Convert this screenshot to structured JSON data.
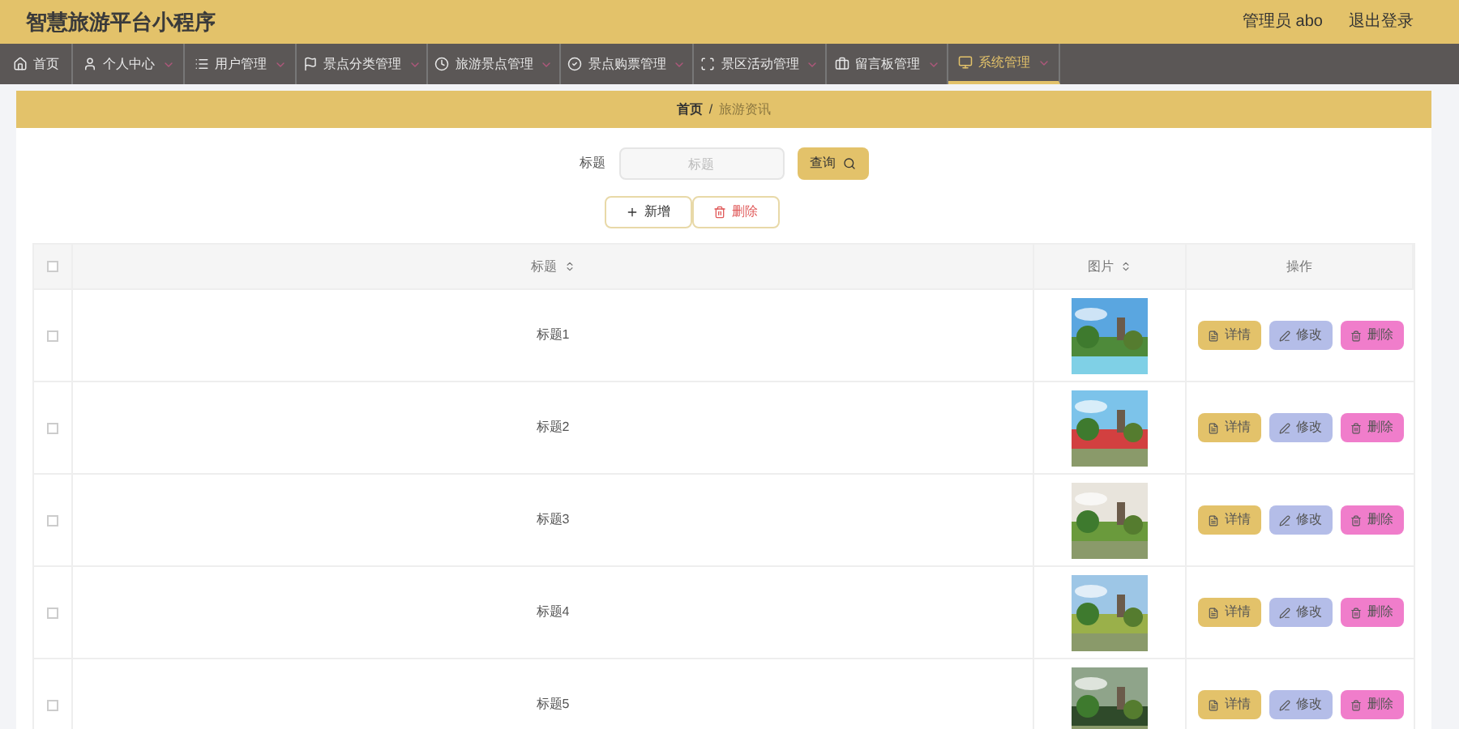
{
  "header": {
    "title": "智慧旅游平台小程序",
    "user": "管理员 abo",
    "logout": "退出登录"
  },
  "nav": [
    {
      "label": "首页",
      "dropdown": false,
      "selected": false
    },
    {
      "label": "个人中心",
      "dropdown": true,
      "selected": false
    },
    {
      "label": "用户管理",
      "dropdown": true,
      "selected": false
    },
    {
      "label": "景点分类管理",
      "dropdown": true,
      "selected": false
    },
    {
      "label": "旅游景点管理",
      "dropdown": true,
      "selected": false
    },
    {
      "label": "景点购票管理",
      "dropdown": true,
      "selected": false
    },
    {
      "label": "景区活动管理",
      "dropdown": true,
      "selected": false
    },
    {
      "label": "留言板管理",
      "dropdown": true,
      "selected": false
    },
    {
      "label": "系统管理",
      "dropdown": true,
      "selected": true
    }
  ],
  "breadcrumb": {
    "home": "首页",
    "separator": "/",
    "current": "旅游资讯"
  },
  "search": {
    "label": "标题",
    "placeholder": "标题",
    "button": "查询"
  },
  "actions": {
    "add": "新增",
    "delete": "删除"
  },
  "table": {
    "all_checked": false,
    "columns": [
      {
        "label": "标题",
        "sortable": true
      },
      {
        "label": "图片",
        "sortable": true
      },
      {
        "label": "操作",
        "sortable": false
      }
    ],
    "rows": [
      {
        "title": "标题1",
        "checked": false,
        "buttons": [
          "详情",
          "修改",
          "删除"
        ]
      },
      {
        "title": "标题2",
        "checked": false,
        "buttons": [
          "详情",
          "修改",
          "删除"
        ]
      },
      {
        "title": "标题3",
        "checked": false,
        "buttons": [
          "详情",
          "修改",
          "删除"
        ]
      },
      {
        "title": "标题4",
        "checked": false,
        "buttons": [
          "详情",
          "修改",
          "删除"
        ]
      },
      {
        "title": "标题5",
        "checked": false,
        "buttons": [
          "详情",
          "修改",
          "删除"
        ]
      }
    ]
  }
}
